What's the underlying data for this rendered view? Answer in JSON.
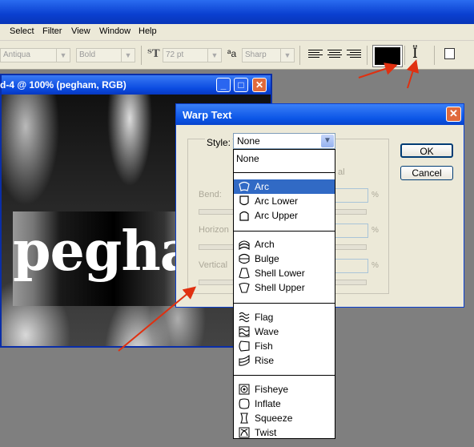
{
  "menubar": [
    "Select",
    "Filter",
    "View",
    "Window",
    "Help"
  ],
  "options_bar": {
    "font_family": "Antiqua",
    "font_style": "Bold",
    "font_size": "72 pt",
    "anti_alias": "Sharp",
    "text_color": "#000000"
  },
  "document": {
    "title": "d-4 @ 100% (pegham, RGB)",
    "canvas_text": "peghar"
  },
  "dialog": {
    "title": "Warp Text",
    "style_label": "Style:",
    "style_value": "None",
    "horizontal_partial": "al",
    "bend_label": "Bend:",
    "horizontal_label": "Horizon",
    "vertical_label": "Vertical",
    "percent": "%",
    "ok_label": "OK",
    "cancel_label": "Cancel"
  },
  "style_options": [
    {
      "label": "None",
      "icon": ""
    },
    {
      "label": "Arc",
      "icon": "arc-icon"
    },
    {
      "label": "Arc Lower",
      "icon": "arc-lower-icon"
    },
    {
      "label": "Arc Upper",
      "icon": "arc-upper-icon"
    },
    {
      "label": "Arch",
      "icon": "arch-icon"
    },
    {
      "label": "Bulge",
      "icon": "bulge-icon"
    },
    {
      "label": "Shell Lower",
      "icon": "shell-lower-icon"
    },
    {
      "label": "Shell Upper",
      "icon": "shell-upper-icon"
    },
    {
      "label": "Flag",
      "icon": "flag-icon"
    },
    {
      "label": "Wave",
      "icon": "wave-icon"
    },
    {
      "label": "Fish",
      "icon": "fish-icon"
    },
    {
      "label": "Rise",
      "icon": "rise-icon"
    },
    {
      "label": "Fisheye",
      "icon": "fisheye-icon"
    },
    {
      "label": "Inflate",
      "icon": "inflate-icon"
    },
    {
      "label": "Squeeze",
      "icon": "squeeze-icon"
    },
    {
      "label": "Twist",
      "icon": "twist-icon"
    }
  ],
  "selected_style": "Arc",
  "colors": {
    "selection": "#316ac5",
    "annotation_arrow": "#e03010",
    "titlebar": "#0a4ae0"
  }
}
